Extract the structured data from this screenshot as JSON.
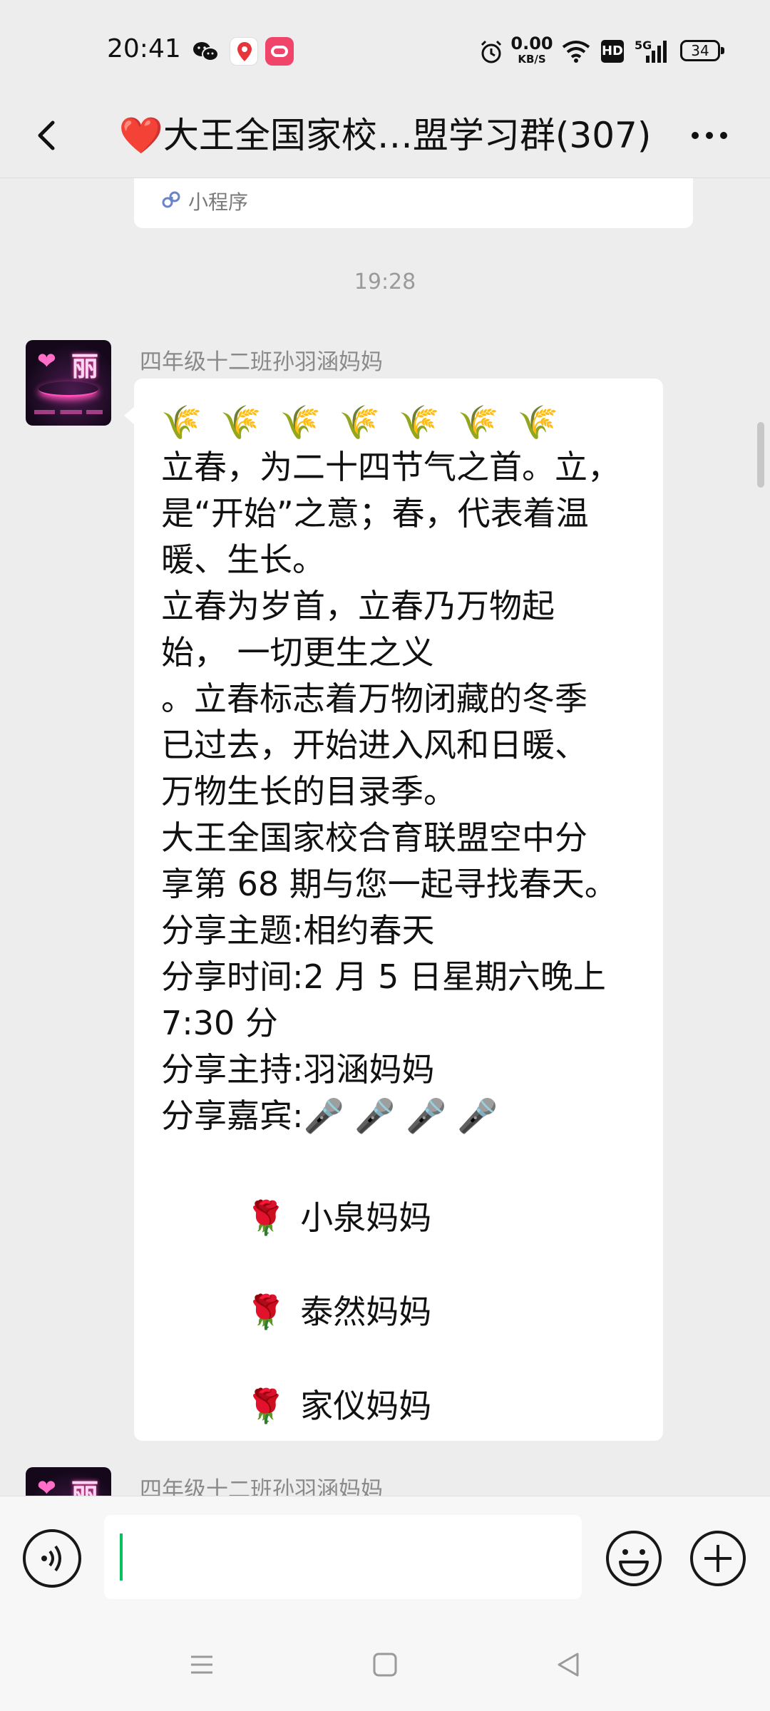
{
  "status_bar": {
    "time": "20:41",
    "net_speed_value": "0.00",
    "net_speed_unit": "KB/S",
    "hd_label": "HD",
    "network_label": "5G",
    "battery_level": "34",
    "icons": [
      "wechat-icon",
      "location-app-icon",
      "red-app-icon",
      "alarm-icon",
      "wifi-icon",
      "signal-icon",
      "battery-icon"
    ]
  },
  "header": {
    "title": "❤️大王全国家校…盟学习群(307)",
    "back_icon": "chevron-left-icon",
    "more_icon": "more-dots-icon"
  },
  "mini_program_card": {
    "label": "小程序",
    "icon": "mini-program-icon"
  },
  "timestamp": "19:28",
  "messages": [
    {
      "sender": "四年级十二班孙羽涵妈妈",
      "avatar_text": "丽",
      "emoji_row": "🌾🌾🌾🌾🌾🌾🌾",
      "lines": [
        "立春，为二十四节气之首。立，",
        "是“开始”之意；春，代表着温",
        "暖、生长。",
        " 立春为岁首，立春乃万物起",
        "始， 一切更生之义",
        "。立春标志着万物闭藏的冬季",
        "已过去，开始进入风和日暖、",
        "万物生长的目录季。",
        "大王全国家校合育联盟空中分",
        "享第 68 期与您一起寻找春天。",
        "分享主题:相约春天",
        "分享时间:2 月 5 日星期六晚上",
        "7:30 分",
        "分享主持:羽涵妈妈",
        "分享嘉宾:🎤 🎤 🎤 🎤"
      ],
      "guests": [
        {
          "icon": "🌹",
          "name": "小泉妈妈"
        },
        {
          "icon": "🌹",
          "name": "泰然妈妈"
        },
        {
          "icon": "🌹",
          "name": "家仪妈妈"
        }
      ]
    },
    {
      "sender": "四年级十二班孙羽涵妈妈",
      "avatar_text": "丽"
    }
  ],
  "input_bar": {
    "value": "",
    "voice_icon": "voice-icon",
    "emoji_icon": "emoji-icon",
    "plus_icon": "plus-icon"
  },
  "nav_bar": {
    "icons": [
      "menu-icon",
      "home-square-icon",
      "back-triangle-icon"
    ]
  },
  "colors": {
    "background": "#ededed",
    "bubble": "#ffffff",
    "caret": "#07c160",
    "name_text": "#8a8a8a"
  }
}
